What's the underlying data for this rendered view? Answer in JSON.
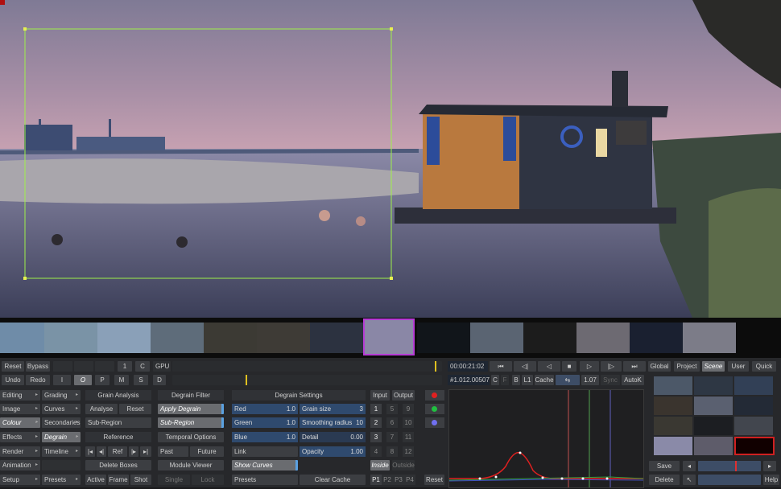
{
  "viewer": {
    "title": "viewer"
  },
  "toolbar": {
    "reset": "Reset",
    "bypass": "Bypass",
    "one": "1",
    "c": "C",
    "gpu": "GPU",
    "undo": "Undo",
    "redo": "Redo",
    "i": "I",
    "o": "O",
    "p": "P",
    "m": "M",
    "s": "S",
    "d": "D"
  },
  "transport": {
    "timecode": "00:00:21:02",
    "frame": "#1.012.00507",
    "c": "C",
    "f": "F",
    "b": "B",
    "l1": "L1",
    "cache": "Cache",
    "zoom": "1.07",
    "sync": "Sync",
    "autok": "AutoK"
  },
  "scope_tabs": [
    "Global",
    "Project",
    "Scene",
    "User",
    "Quick"
  ],
  "menu": [
    {
      "label": "Editing"
    },
    {
      "label": "Image"
    },
    {
      "label": "Colour"
    },
    {
      "label": "Effects"
    },
    {
      "label": "Render"
    },
    {
      "label": "Animation"
    },
    {
      "label": "Setup"
    }
  ],
  "submenu": [
    {
      "label": "Grading"
    },
    {
      "label": "Curves"
    },
    {
      "label": "Secondaries"
    },
    {
      "label": "Degrain"
    },
    {
      "label": "Timeline"
    },
    {
      "label": ""
    },
    {
      "label": "Presets"
    }
  ],
  "grain_analysis": {
    "title": "Grain Analysis",
    "analyse": "Analyse",
    "reset": "Reset",
    "subregion": "Sub-Region",
    "reference": "Reference",
    "ref": "Ref",
    "delete_boxes": "Delete Boxes",
    "active": "Active",
    "frame": "Frame",
    "shot": "Shot"
  },
  "degrain_filter": {
    "title": "Degrain Filter",
    "apply": "Apply Degrain",
    "subregion": "Sub-Region",
    "temporal": "Temporal Options",
    "past": "Past",
    "future": "Future",
    "module_viewer": "Module Viewer",
    "single": "Single",
    "lock": "Lock"
  },
  "degrain_settings": {
    "title": "Degrain Settings",
    "red": {
      "label": "Red",
      "value": "1.0"
    },
    "green": {
      "label": "Green",
      "value": "1.0"
    },
    "blue": {
      "label": "Blue",
      "value": "1.0"
    },
    "grain_size": {
      "label": "Grain size",
      "value": "3"
    },
    "smoothing": {
      "label": "Smoothing radius",
      "value": "10"
    },
    "detail": {
      "label": "Detail",
      "value": "0.00"
    },
    "link": "Link",
    "opacity": {
      "label": "Opacity",
      "value": "1.00"
    },
    "show_curves": "Show Curves",
    "presets": "Presets",
    "clear_cache": "Clear Cache"
  },
  "io": {
    "input": "Input",
    "output": "Output",
    "nums": [
      "1",
      "5",
      "9",
      "2",
      "6",
      "10",
      "3",
      "7",
      "11",
      "4",
      "8",
      "12"
    ],
    "inside": "Inside",
    "outside": "Outside",
    "p": [
      "P1",
      "P2",
      "P3",
      "P4"
    ],
    "reset": "Reset"
  },
  "right_panel": {
    "save": "Save",
    "delete": "Delete",
    "help": "Help"
  },
  "colors": {
    "accent": "#3d4d66",
    "selected_thumb": "#b63bd4",
    "box": "#9ef04a"
  }
}
